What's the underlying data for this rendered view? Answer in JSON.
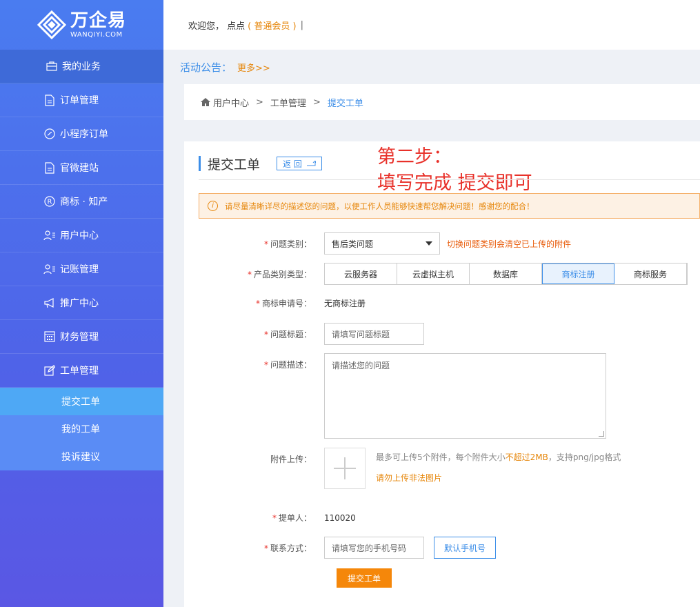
{
  "brand": {
    "name_cn": "万企易",
    "name_en": "WANQIYI.COM"
  },
  "sidebar": {
    "items": [
      {
        "label": "我的业务",
        "icon": "briefcase-icon"
      },
      {
        "label": "订单管理",
        "icon": "document-icon"
      },
      {
        "label": "小程序订单",
        "icon": "miniapp-icon"
      },
      {
        "label": "官微建站",
        "icon": "document-icon"
      },
      {
        "label": "商标 · 知产",
        "icon": "registered-icon"
      },
      {
        "label": "用户中心",
        "icon": "user-list-icon"
      },
      {
        "label": "记账管理",
        "icon": "user-list-icon"
      },
      {
        "label": "推广中心",
        "icon": "megaphone-icon"
      },
      {
        "label": "财务管理",
        "icon": "calculator-icon"
      },
      {
        "label": "工单管理",
        "icon": "edit-icon"
      }
    ],
    "subitems": [
      {
        "label": "提交工单"
      },
      {
        "label": "我的工单"
      },
      {
        "label": "投诉建议"
      }
    ]
  },
  "topbar": {
    "welcome": "欢迎您， 点点",
    "member": "( 普通会员 )",
    "divider": "|"
  },
  "notice": {
    "title": "活动公告：",
    "more": "更多>>"
  },
  "breadcrumb": {
    "home": "用户中心",
    "sep": ">",
    "level2": "工单管理",
    "current": "提交工单"
  },
  "card": {
    "title": "提交工单",
    "back": "返 回",
    "annotation_line1": "第二步：",
    "annotation_line2": "填写完成 提交即可"
  },
  "tip": "请尽量清晰详尽的描述您的问题，以便工作人员能够快速帮您解决问题！感谢您的配合！",
  "form": {
    "category": {
      "label": "问题类别：",
      "value": "售后类问题",
      "warn": "切换问题类别会清空已上传的附件"
    },
    "product": {
      "label": "产品类别类型：",
      "options": [
        "云服务器",
        "云虚拟主机",
        "数据库",
        "商标注册",
        "商标服务"
      ],
      "selected": "商标注册"
    },
    "trademark_no": {
      "label": "商标申请号：",
      "value": "无商标注册"
    },
    "issue_title": {
      "label": "问题标题：",
      "placeholder": "请填写问题标题"
    },
    "issue_desc": {
      "label": "问题描述：",
      "placeholder": "请描述您的问题"
    },
    "attachment": {
      "label": "附件上传：",
      "info_prefix": "最多可上传5个附件，每个附件大小",
      "info_highlight": "不超过2MB",
      "info_suffix": "，支持png/jpg格式",
      "warning": "请勿上传非法图片"
    },
    "submitter": {
      "label": "提单人：",
      "value": "110020"
    },
    "contact": {
      "label": "联系方式：",
      "placeholder": "请填写您的手机号码",
      "default_btn": "默认手机号"
    },
    "submit": "提交工单"
  }
}
